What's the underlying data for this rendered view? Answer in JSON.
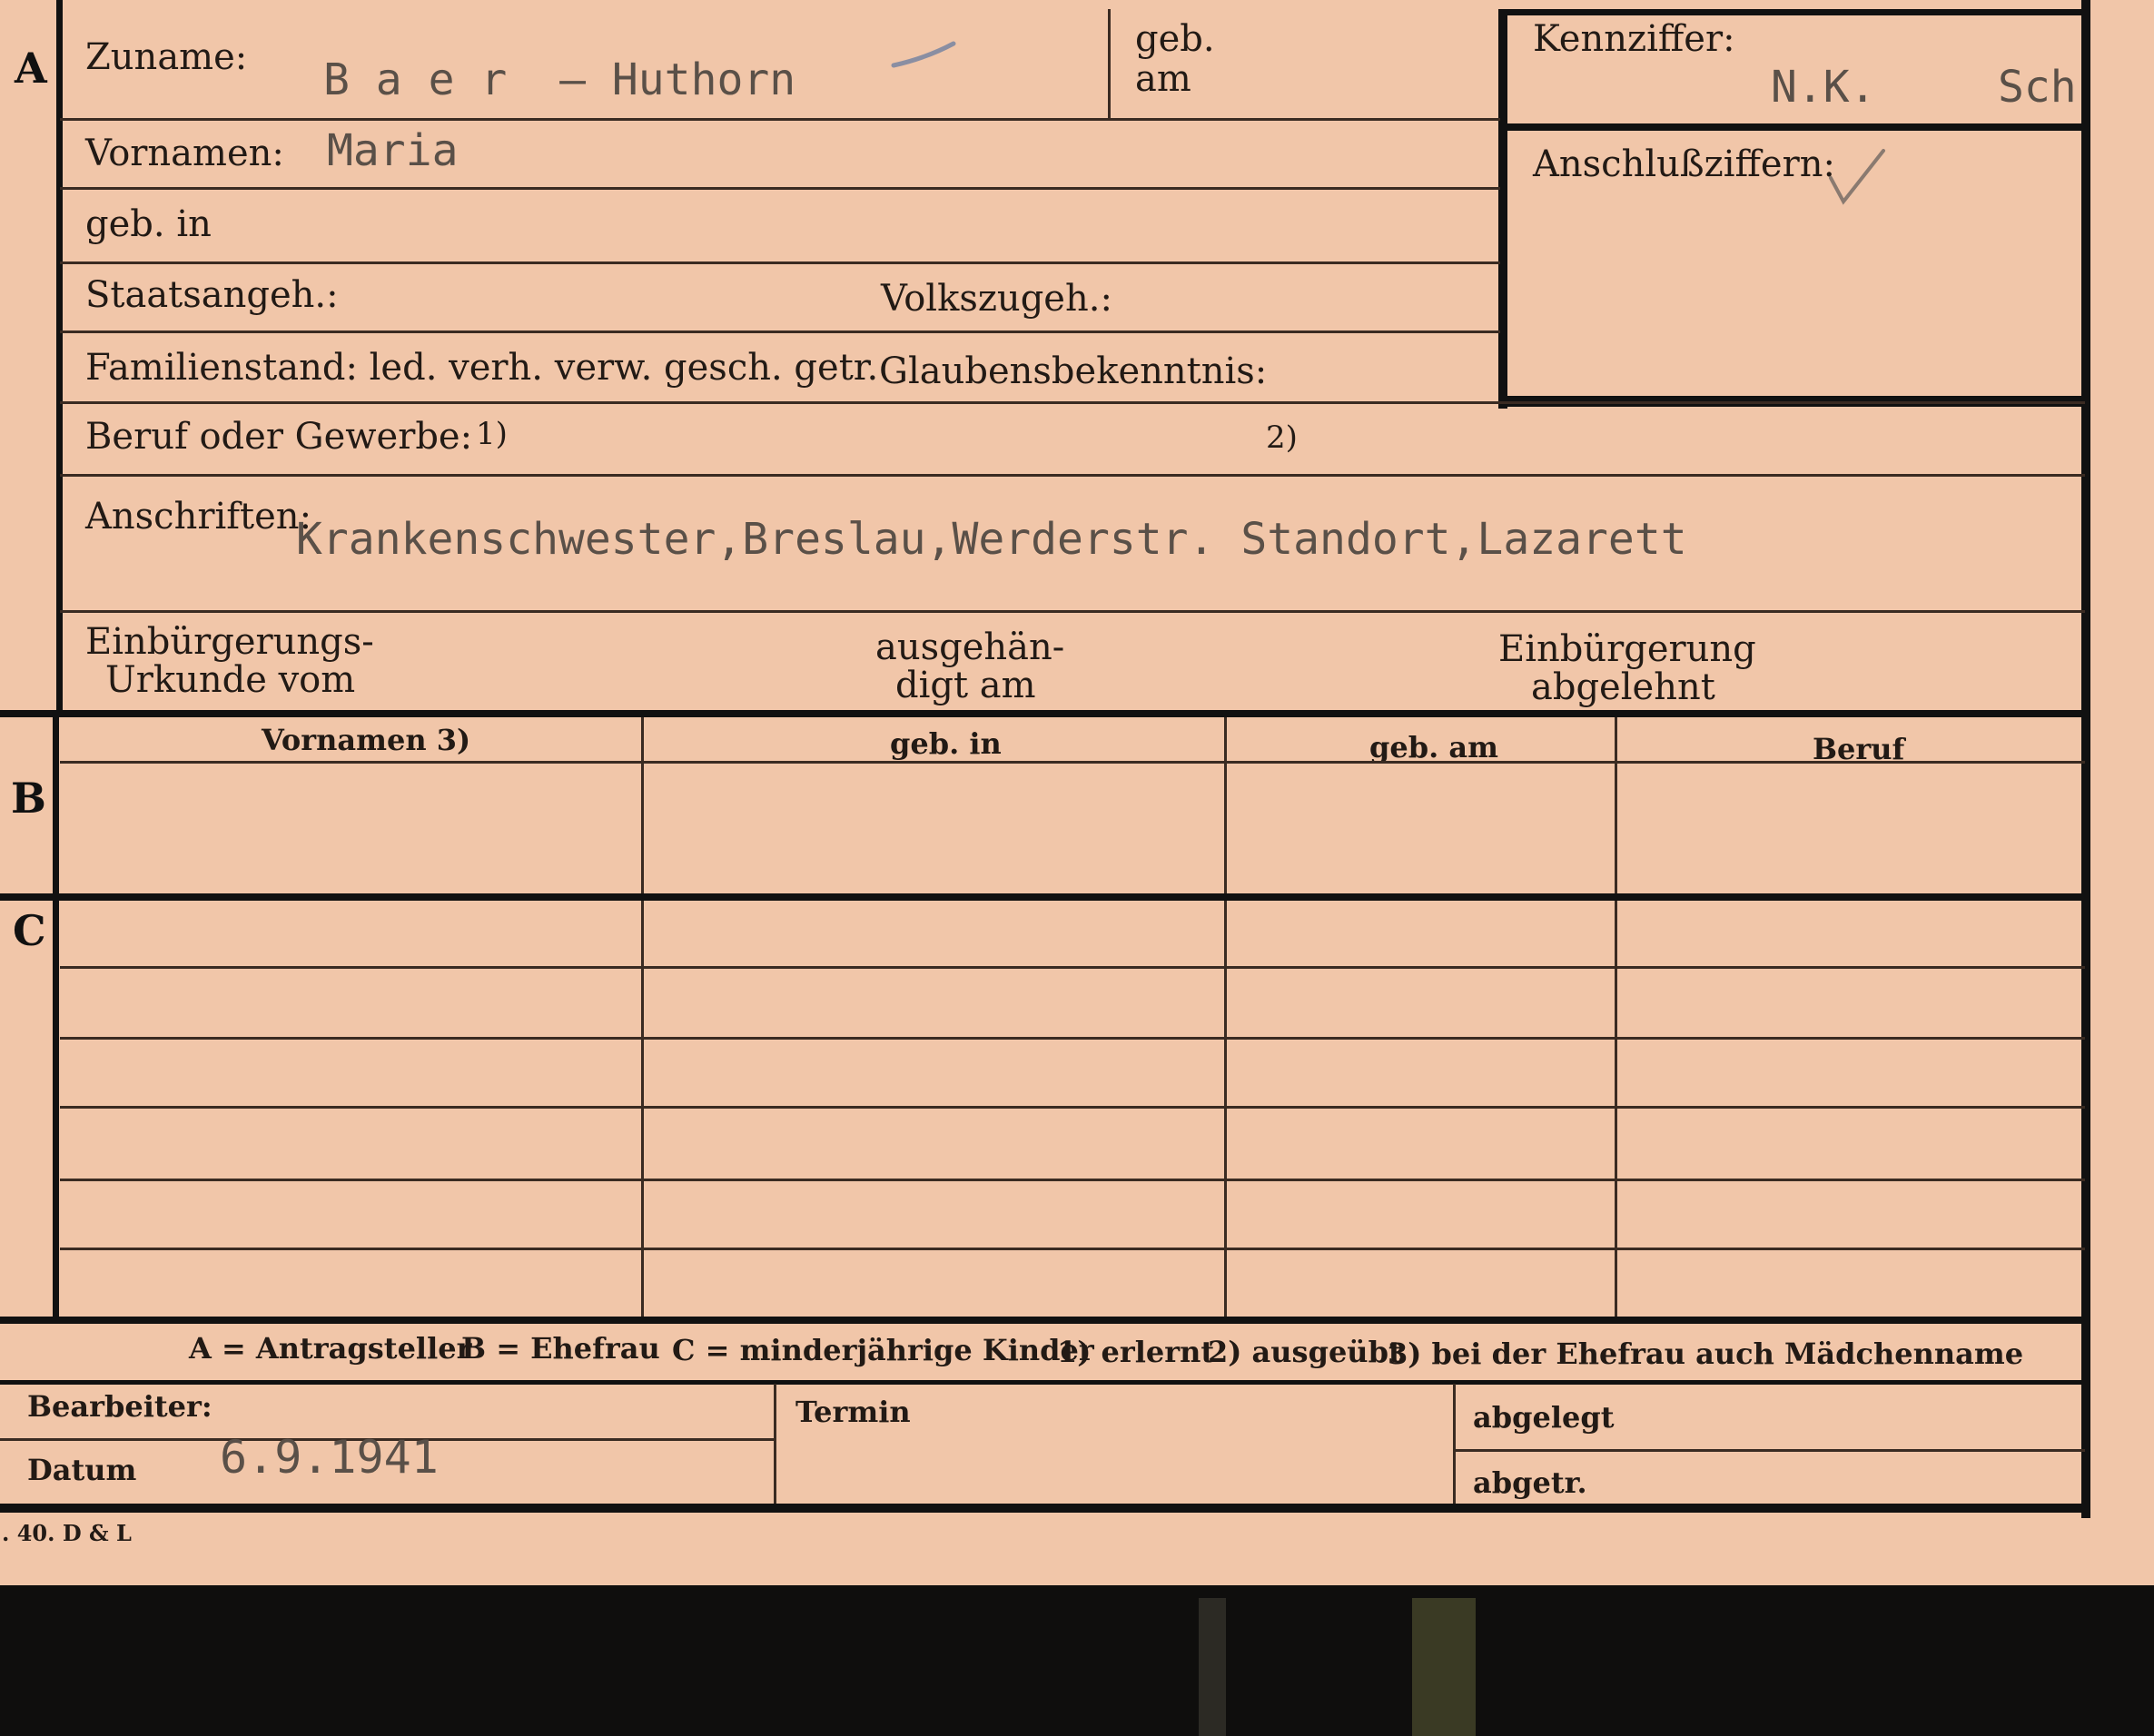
{
  "sections": {
    "a": "A",
    "b": "B",
    "c": "C"
  },
  "fields": {
    "zuname_label": "Zuname:",
    "zuname_value": "B a e r  – Huthorn",
    "geb_am_label_1": "geb.",
    "geb_am_label_2": "am",
    "kennziffer_label": "Kennziffer:",
    "kennziffer_value_1": "N.K.",
    "kennziffer_value_2": "Sch",
    "vornamen_label": "Vornamen:",
    "vornamen_value": "Maria",
    "anschlussziffern_label": "Anschlußziffern:",
    "geb_in_label": "geb. in",
    "staatsangeh_label": "Staatsangeh.:",
    "volkszugeh_label": "Volkszugeh.:",
    "familienstand_label": "Familienstand: led. verh. verw. gesch. getr.",
    "glaubensbekenntnis_label": "Glaubensbekenntnis:",
    "beruf_label": "Beruf oder Gewerbe:",
    "beruf_note1": "1)",
    "beruf_note2": "2)",
    "anschriften_label": "Anschriften:",
    "anschriften_value": "Krankenschwester,Breslau,Werderstr. Standort,Lazarett",
    "einbuergerung_label_1": "Einbürgerungs-",
    "einbuergerung_label_2": "Urkunde vom",
    "ausgehaendigt_label_1": "ausgehän-",
    "ausgehaendigt_label_2": "digt am",
    "abgelehnt_label_1": "Einbürgerung",
    "abgelehnt_label_2": "abgelehnt"
  },
  "table": {
    "headers": [
      "Vornamen 3)",
      "geb. in",
      "geb. am",
      "Beruf"
    ]
  },
  "legend": {
    "a": "A = Antragsteller",
    "b": "B = Ehefrau",
    "c": "C = minderjährige Kinder",
    "n1": "1) erlernt",
    "n2": "2) ausgeübt",
    "n3": "3) bei der Ehefrau auch Mädchenname"
  },
  "footer": {
    "bearbeiter_label": "Bearbeiter:",
    "datum_label": "Datum",
    "datum_value": "6.9.1941",
    "termin_label": "Termin",
    "abgelegt_label": "abgelegt",
    "abgetr_label": "abgetr.",
    "printer_mark": ". 40. D & L"
  }
}
